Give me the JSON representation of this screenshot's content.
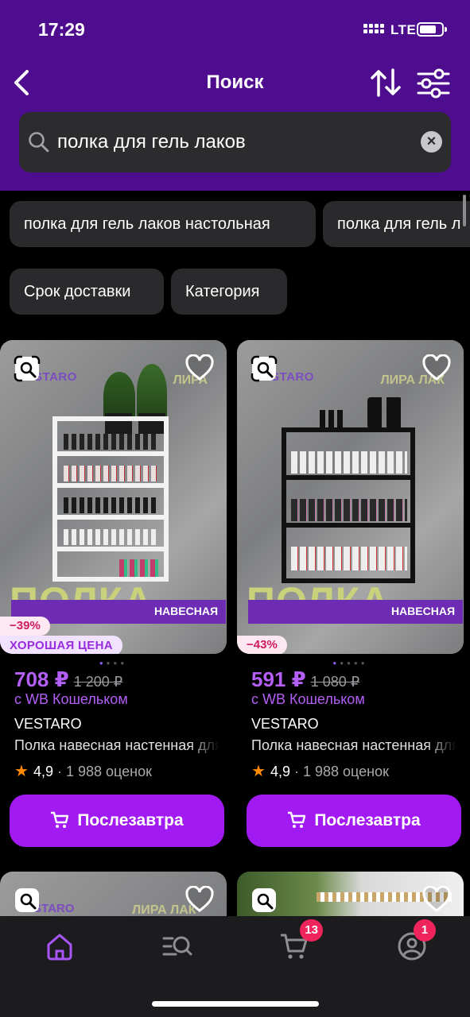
{
  "status": {
    "time": "17:29",
    "network": "LTE"
  },
  "nav": {
    "title": "Поиск"
  },
  "search": {
    "query": "полка для гель лаков",
    "clear_icon": "×"
  },
  "suggestions": [
    "полка для гель лаков настольная",
    "полка для гель л"
  ],
  "filters": [
    "Срок доставки",
    "Категория"
  ],
  "products": [
    {
      "brand_mark": "VESTARO",
      "poster_title": "ПОЛКА",
      "poster_subtitle": "НАВЕСНАЯ",
      "poster_corner": "ЛИРА",
      "discount": "−39%",
      "tag": "ХОРОШАЯ ЦЕНА",
      "price": "708 ₽",
      "old_price": "1 200 ₽",
      "wallet": "с WB Кошельком",
      "brand": "VESTARO",
      "name": "Полка навесная настенная для",
      "rating": "4,9",
      "reviews": "· 1 988 оценок",
      "cta": "Послезавтра",
      "shelf_color": "#f2f2f2"
    },
    {
      "brand_mark": "VESTARO",
      "poster_title": "ПОЛКА",
      "poster_subtitle": "НАВЕСНАЯ",
      "poster_corner": "ЛИРА ЛАК",
      "discount": "−43%",
      "tag": "",
      "price": "591 ₽",
      "old_price": "1 080 ₽",
      "wallet": "с WB Кошельком",
      "brand": "VESTARO",
      "name": "Полка навесная настенная для",
      "rating": "4,9",
      "reviews": "· 1 988 оценок",
      "cta": "Послезавтра",
      "shelf_color": "#111111"
    }
  ],
  "partial_cards": [
    {
      "brand_mark": "VESTARO",
      "poster_corner": "ЛИРА ЛАК"
    },
    {
      "brand_mark": ""
    }
  ],
  "tabbar": {
    "items": [
      "home-icon",
      "catalog-search-icon",
      "cart-icon",
      "profile-icon"
    ],
    "cart_badge": "13",
    "profile_badge": "1"
  },
  "colors": {
    "header": "#4e0d8e",
    "accent": "#a21af2",
    "price": "#b35ef5",
    "badge": "#f0245c"
  }
}
